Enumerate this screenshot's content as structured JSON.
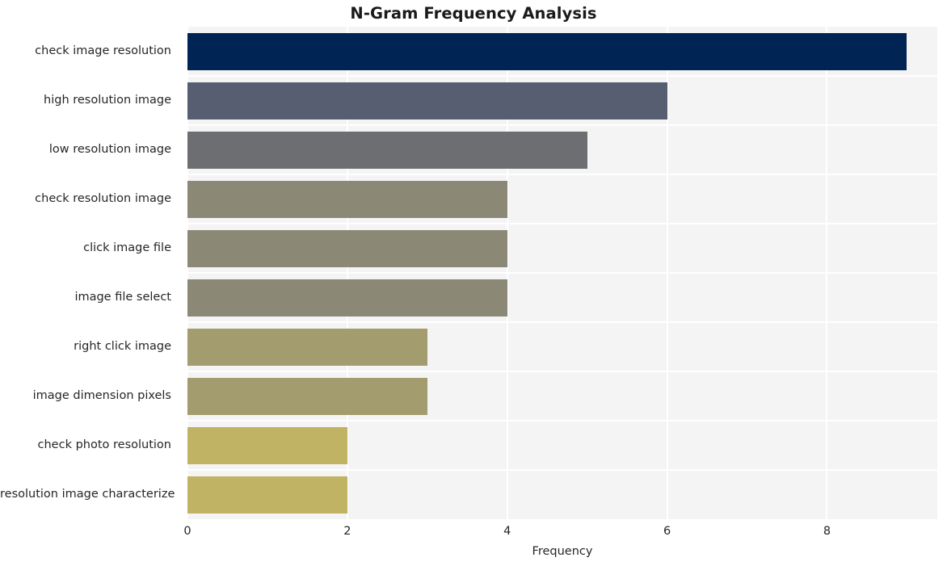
{
  "chart_data": {
    "type": "bar",
    "orientation": "horizontal",
    "title": "N-Gram Frequency Analysis",
    "xlabel": "Frequency",
    "ylabel": "",
    "categories": [
      "check image resolution",
      "high resolution image",
      "low resolution image",
      "check resolution image",
      "click image file",
      "image file select",
      "right click image",
      "image dimension pixels",
      "check photo resolution",
      "resolution image characterize"
    ],
    "values": [
      9,
      6,
      5,
      4,
      4,
      4,
      3,
      3,
      2,
      2
    ],
    "xlim": [
      0,
      9.38
    ],
    "xticks": [
      "0",
      "2",
      "4",
      "6",
      "8"
    ],
    "xtick_values": [
      0,
      2,
      4,
      6,
      8
    ],
    "grid": true,
    "legend": null,
    "colormap": "cividis_r",
    "bar_colors": [
      "#002454",
      "#575e71",
      "#6d6e71",
      "#8b8876",
      "#8b8876",
      "#8b8876",
      "#a39c6e",
      "#a39c6e",
      "#c0b464",
      "#c0b464"
    ],
    "plot_background": "#f4f4f5",
    "grid_color": "#ffffff",
    "figure_background": "#ffffff",
    "title_color": "#1a1a1a",
    "tick_color": "#262626"
  }
}
